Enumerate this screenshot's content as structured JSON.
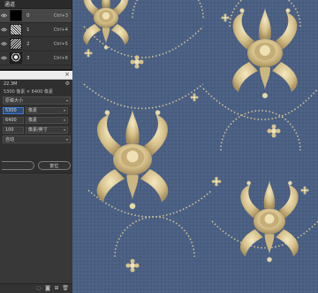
{
  "channels_panel": {
    "title": "通道",
    "channels": [
      {
        "name": "0",
        "shortcut": "Ctrl+3",
        "selected": true
      },
      {
        "name": "1",
        "shortcut": "Ctrl+4",
        "selected": false
      },
      {
        "name": "2",
        "shortcut": "Ctrl+5",
        "selected": false
      },
      {
        "name": "3",
        "shortcut": "Ctrl+6",
        "selected": false
      }
    ]
  },
  "resize_panel": {
    "file_size": "22.3M",
    "dimensions_text": "5300 像素 × 6400 像素",
    "preset": "原稿大小",
    "width": {
      "value": "5300",
      "unit": "像素"
    },
    "height": {
      "value": "6400",
      "unit": "像素"
    },
    "resolution": {
      "value": "100",
      "unit": "像素/英寸"
    },
    "resample": "自动",
    "buttons": {
      "cancel": "",
      "reset": "复位"
    }
  },
  "icons": {
    "visibility": "eye-icon",
    "close": "close-icon",
    "settings": "gear-icon",
    "dropdown": "chevron-down-icon",
    "link": "link-icon"
  },
  "colors": {
    "panel_bg": "#2f2f2f",
    "wallpaper_bg": "#4a5f80",
    "ornament_gold": "#d9c99a",
    "active_input": "#3a7bd5"
  }
}
